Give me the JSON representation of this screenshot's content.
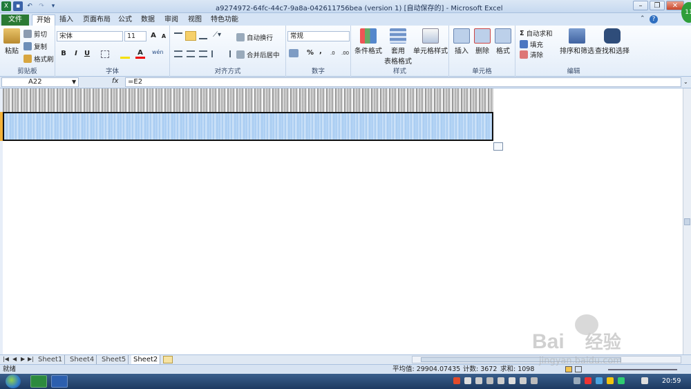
{
  "window": {
    "title": "a9274972-64fc-44c7-9a8a-042611756bea (version 1) [自动保存的] - Microsoft Excel"
  },
  "tabs": [
    {
      "label": "文件"
    },
    {
      "label": "开始"
    },
    {
      "label": "插入"
    },
    {
      "label": "页面布局"
    },
    {
      "label": "公式"
    },
    {
      "label": "数据"
    },
    {
      "label": "审阅"
    },
    {
      "label": "视图"
    },
    {
      "label": "特色功能"
    }
  ],
  "ribbon": {
    "clipboard": {
      "paste": "粘贴",
      "cut": "剪切",
      "copy": "复制",
      "format_painter": "格式刷",
      "label": "剪贴板"
    },
    "font": {
      "name": "宋体",
      "size": "11",
      "label": "字体",
      "bold": "B",
      "italic": "I",
      "underline": "U",
      "phonetic": "wén"
    },
    "alignment": {
      "wrap": "自动换行",
      "merge": "合并后居中",
      "label": "对齐方式"
    },
    "number": {
      "format": "常规",
      "percent": "%",
      "comma": ",",
      "label": "数字"
    },
    "styles": {
      "conditional": "条件格式",
      "table_line1": "套用",
      "table_line2": "表格格式",
      "cell_styles": "单元格样式",
      "label": "样式"
    },
    "cells": {
      "insert": "插入",
      "delete": "删除",
      "format": "格式",
      "label": "单元格"
    },
    "editing": {
      "autosum": "自动求和",
      "fill": "填充",
      "clear": "清除",
      "sort": "排序和筛选",
      "find": "查找和选择",
      "label": "编辑"
    }
  },
  "formula_bar": {
    "name_box": "A22",
    "fx": "fx",
    "formula": "=E2"
  },
  "sheet_tabs": [
    {
      "label": "Sheet1",
      "active": false
    },
    {
      "label": "Sheet4",
      "active": false
    },
    {
      "label": "Sheet5",
      "active": false
    },
    {
      "label": "Sheet2",
      "active": true
    }
  ],
  "status": {
    "ready": "就绪",
    "average": "平均值: 29904.07435",
    "count": "计数: 3672",
    "sum": "求和: 1098"
  },
  "taskbar": {
    "clock": "20:59"
  },
  "watermark": {
    "text1": "Bai",
    "text2": "经验",
    "url": "jingyan.baidu.com"
  },
  "colors": {
    "file_tab": "#2b7a34",
    "selection": "#a8cdf4",
    "row_header_selected": "#f3b23a",
    "taskbar": "#1d3a62"
  }
}
